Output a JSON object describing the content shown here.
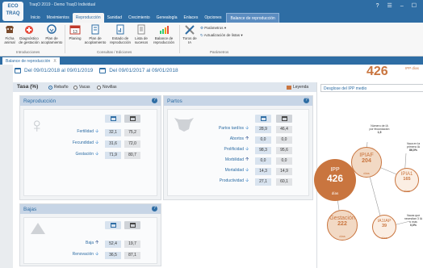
{
  "app": {
    "logo_text": "ECO TRAQ",
    "title": "TraqO 2019 - Demo TraqO Individual",
    "menu": [
      "Inicio",
      "Movimientos",
      "Reproducción",
      "Sanidad",
      "Crecimiento",
      "Genealogía",
      "Enlaces",
      "Opciones",
      "Balance de reproducción"
    ],
    "win_controls": [
      "?",
      "☰",
      "–",
      "☐"
    ]
  },
  "ribbon": {
    "buttons": [
      {
        "label": "Ficha animal"
      },
      {
        "label": "Diagnóstico de gestación"
      },
      {
        "label": "Plan de acoplamiento"
      },
      {
        "label": "Planing"
      },
      {
        "label": "Plan de acoplamiento"
      },
      {
        "label": "Estado de reproducción"
      },
      {
        "label": "Lista de sucesos"
      },
      {
        "label": "Balance de reproducción"
      },
      {
        "label": "Toros de IA"
      }
    ],
    "small_buttons": [
      "Parámetros",
      "Actualización de listas"
    ],
    "groups": [
      "Introducciones",
      "Consultas / Ediciones",
      "Parámetros"
    ]
  },
  "doctab": {
    "label": "Balance de reproducción",
    "close": "X"
  },
  "dates": {
    "range1": "Del 09/01/2018 al 09/01/2019",
    "range2": "Del 09/01/2017 al 09/01/2018"
  },
  "kpi": {
    "value": "426",
    "unit": "IPP días"
  },
  "tasa": {
    "label": "Tasa (%)",
    "options": [
      "Rebaño",
      "Vacas",
      "Novillas"
    ],
    "selected": "Rebaño",
    "legend": "Leyenda"
  },
  "reproduccion": {
    "title": "Reproducción",
    "help": "?",
    "rows": [
      {
        "label": "Fertilidad",
        "trend": "down",
        "v1": "32,1",
        "v2": "75,2"
      },
      {
        "label": "Fecundidad",
        "trend": "down",
        "v1": "31,6",
        "v2": "72,0"
      },
      {
        "label": "Gestación",
        "trend": "down",
        "v1": "71,9",
        "v2": "80,7"
      }
    ]
  },
  "partos": {
    "title": "Partos",
    "help": "?",
    "rows": [
      {
        "label": "Partos tardíos",
        "trend": "down",
        "v1": "28,9",
        "v2": "46,4"
      },
      {
        "label": "Abortos",
        "trend": "up",
        "v1": "0,0",
        "v2": "0,0"
      },
      {
        "label": "Prolificidad",
        "trend": "down",
        "v1": "98,3",
        "v2": "95,6"
      },
      {
        "label": "Morbilidad",
        "trend": "up",
        "v1": "0,0",
        "v2": "0,0"
      },
      {
        "label": "Mortalidad",
        "trend": "down",
        "v1": "14,3",
        "v2": "14,9"
      },
      {
        "label": "Productividad",
        "trend": "down",
        "v1": "27,1",
        "v2": "60,1"
      }
    ]
  },
  "bajas": {
    "title": "Bajas",
    "help": "?",
    "rows": [
      {
        "label": "Baja",
        "trend": "up",
        "v1": "52,4",
        "v2": "19,7"
      },
      {
        "label": "Renovación",
        "trend": "down",
        "v1": "36,5",
        "v2": "87,1"
      }
    ]
  },
  "diagram": {
    "select": "Desglose del IPP medio",
    "ipp": {
      "title": "IPP",
      "value": "426",
      "unit": "días"
    },
    "ipiaf": {
      "title": "IPIAF",
      "value": "204",
      "unit": "días"
    },
    "ipia1": {
      "title": "IPIA1",
      "value": "165",
      "unit": "días"
    },
    "gestacion": {
      "title": "Gestación",
      "value": "222",
      "unit": "días"
    },
    "iaiap": {
      "title": "IA1IAP",
      "value": "39",
      "unit": "días"
    },
    "note1": {
      "label": "Número de IA por fecundación",
      "value": "1,5"
    },
    "note2": {
      "label": "Vaca en la primera IA",
      "value": "86,0%"
    },
    "note3": {
      "label": "Vacas que necesitan 3 IA o más",
      "value": "0,0%"
    },
    "colors": {
      "orange": "#c9753f",
      "light_orange": "#f2d9c4",
      "tan": "#d9a77f"
    }
  }
}
